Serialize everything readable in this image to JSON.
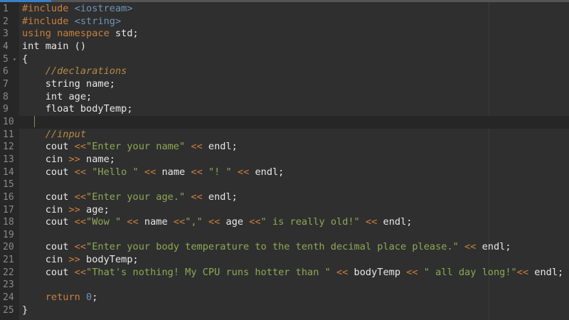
{
  "editor": {
    "lines": [
      [
        [
          "kw",
          "#include "
        ],
        [
          "inc",
          "<iostream>"
        ]
      ],
      [
        [
          "kw",
          "#include "
        ],
        [
          "inc",
          "<string>"
        ]
      ],
      [
        [
          "kw",
          "using namespace "
        ],
        [
          "t",
          "std;"
        ]
      ],
      [
        [
          "t",
          "int main ()"
        ]
      ],
      [
        [
          "t",
          "{"
        ]
      ],
      [
        [
          "t",
          "    "
        ],
        [
          "cm",
          "//declarations"
        ]
      ],
      [
        [
          "t",
          "    string name;"
        ]
      ],
      [
        [
          "t",
          "    int age;"
        ]
      ],
      [
        [
          "t",
          "    float bodyTemp;"
        ]
      ],
      [],
      [
        [
          "t",
          "    "
        ],
        [
          "cm",
          "//input"
        ]
      ],
      [
        [
          "t",
          "    cout "
        ],
        [
          "op",
          "<<"
        ],
        [
          "str",
          "\"Enter your name\""
        ],
        [
          "t",
          " "
        ],
        [
          "op",
          "<<"
        ],
        [
          "t",
          " endl;"
        ]
      ],
      [
        [
          "t",
          "    cin "
        ],
        [
          "op",
          ">>"
        ],
        [
          "t",
          " name;"
        ]
      ],
      [
        [
          "t",
          "    cout "
        ],
        [
          "op",
          "<<"
        ],
        [
          "t",
          " "
        ],
        [
          "str",
          "\"Hello \""
        ],
        [
          "t",
          " "
        ],
        [
          "op",
          "<<"
        ],
        [
          "t",
          " name "
        ],
        [
          "op",
          "<<"
        ],
        [
          "t",
          " "
        ],
        [
          "str",
          "\"! \""
        ],
        [
          "t",
          " "
        ],
        [
          "op",
          "<<"
        ],
        [
          "t",
          " endl;"
        ]
      ],
      [],
      [
        [
          "t",
          "    cout "
        ],
        [
          "op",
          "<<"
        ],
        [
          "str",
          "\"Enter your age.\""
        ],
        [
          "t",
          " "
        ],
        [
          "op",
          "<<"
        ],
        [
          "t",
          " endl;"
        ]
      ],
      [
        [
          "t",
          "    cin "
        ],
        [
          "op",
          ">>"
        ],
        [
          "t",
          " age;"
        ]
      ],
      [
        [
          "t",
          "    cout "
        ],
        [
          "op",
          "<<"
        ],
        [
          "str",
          "\"Wow \""
        ],
        [
          "t",
          " "
        ],
        [
          "op",
          "<<"
        ],
        [
          "t",
          " name "
        ],
        [
          "op",
          "<<"
        ],
        [
          "str",
          "\",\""
        ],
        [
          "t",
          " "
        ],
        [
          "op",
          "<<"
        ],
        [
          "t",
          " age "
        ],
        [
          "op",
          "<<"
        ],
        [
          "str",
          "\" is really old!\""
        ],
        [
          "t",
          " "
        ],
        [
          "op",
          "<<"
        ],
        [
          "t",
          " endl;"
        ]
      ],
      [],
      [
        [
          "t",
          "    cout "
        ],
        [
          "op",
          "<<"
        ],
        [
          "str",
          "\"Enter your body temperature to the tenth decimal place please.\""
        ],
        [
          "t",
          " "
        ],
        [
          "op",
          "<<"
        ],
        [
          "t",
          " endl;"
        ]
      ],
      [
        [
          "t",
          "    cin "
        ],
        [
          "op",
          ">>"
        ],
        [
          "t",
          " bodyTemp;"
        ]
      ],
      [
        [
          "t",
          "    cout "
        ],
        [
          "op",
          "<<"
        ],
        [
          "str",
          "\"That's nothing! My CPU runs hotter than \""
        ],
        [
          "t",
          " "
        ],
        [
          "op",
          "<<"
        ],
        [
          "t",
          " bodyTemp "
        ],
        [
          "op",
          "<<"
        ],
        [
          "t",
          " "
        ],
        [
          "str",
          "\" all day long!\""
        ],
        [
          "op",
          "<<"
        ],
        [
          "t",
          " endl;"
        ]
      ],
      [],
      [
        [
          "t",
          "    "
        ],
        [
          "kw",
          "return "
        ],
        [
          "num",
          "0"
        ],
        [
          "t",
          ";"
        ]
      ],
      [
        [
          "t",
          "}"
        ]
      ]
    ],
    "active_line": 10,
    "fold_line": 5,
    "fold_icon": "fold-arrow-icon"
  }
}
